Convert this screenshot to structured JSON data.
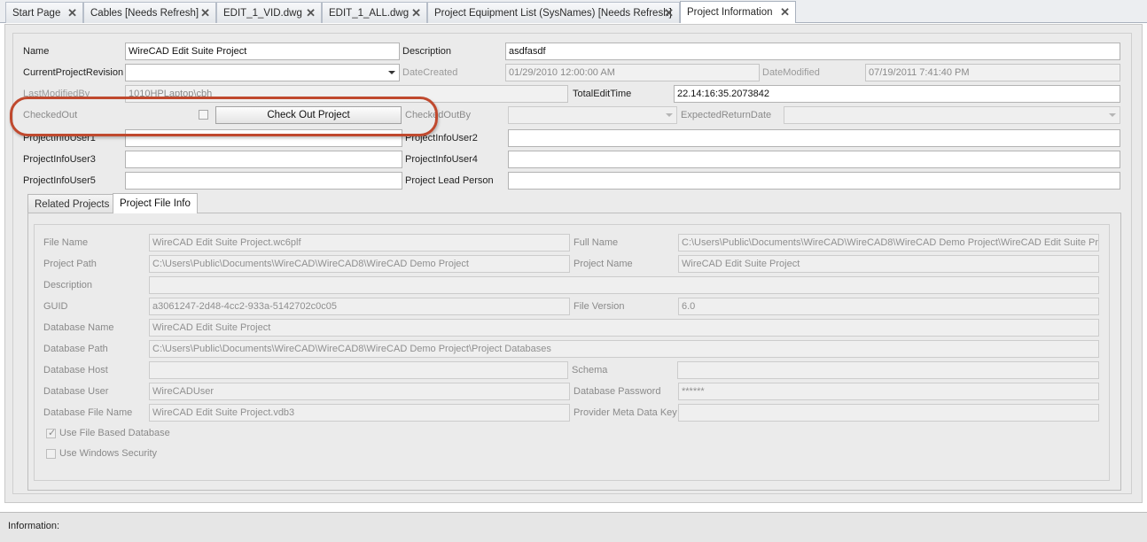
{
  "tabs": [
    {
      "label": "Start Page"
    },
    {
      "label": "Cables [Needs Refresh]"
    },
    {
      "label": "EDIT_1_VID.dwg"
    },
    {
      "label": "EDIT_1_ALL.dwg"
    },
    {
      "label": "Project Equipment List (SysNames) [Needs Refresh]"
    },
    {
      "label": "Project Information"
    }
  ],
  "form": {
    "name_label": "Name",
    "name_value": "WireCAD Edit Suite Project",
    "description_label": "Description",
    "description_value": "asdfasdf",
    "revision_label": "CurrentProjectRevision",
    "revision_value": "",
    "date_created_label": "DateCreated",
    "date_created_value": "01/29/2010 12:00:00 AM",
    "date_modified_label": "DateModified",
    "date_modified_value": "07/19/2011 7:41:40 PM",
    "last_modified_by_label": "LastModifiedBy",
    "last_modified_by_value": "1010HPLaptop\\cbh",
    "total_edit_time_label": "TotalEditTime",
    "total_edit_time_value": "22.14:16:35.2073842",
    "checked_out_label": "CheckedOut",
    "check_out_button": "Check Out Project",
    "checked_out_by_label": "CheckedOutBy",
    "expected_return_label": "ExpectedReturnDate",
    "user1_label": "ProjectInfoUser1",
    "user2_label": "ProjectInfoUser2",
    "user3_label": "ProjectInfoUser3",
    "user4_label": "ProjectInfoUser4",
    "user5_label": "ProjectInfoUser5",
    "lead_label": "Project Lead Person"
  },
  "inner_tabs": [
    {
      "label": "Related Projects"
    },
    {
      "label": "Project File Info"
    }
  ],
  "file_info": {
    "file_name_label": "File Name",
    "file_name_value": "WireCAD Edit Suite Project.wc6plf",
    "full_name_label": "Full Name",
    "full_name_value": "C:\\Users\\Public\\Documents\\WireCAD\\WireCAD8\\WireCAD Demo Project\\WireCAD Edit Suite Pr...",
    "project_path_label": "Project Path",
    "project_path_value": "C:\\Users\\Public\\Documents\\WireCAD\\WireCAD8\\WireCAD Demo Project",
    "project_name_label": "Project Name",
    "project_name_value": "WireCAD Edit Suite Project",
    "description_label": "Description",
    "description_value": "",
    "guid_label": "GUID",
    "guid_value": "a3061247-2d48-4cc2-933a-5142702c0c05",
    "file_version_label": "File Version",
    "file_version_value": "6.0",
    "db_name_label": "Database Name",
    "db_name_value": "WireCAD Edit Suite Project",
    "db_path_label": "Database Path",
    "db_path_value": "C:\\Users\\Public\\Documents\\WireCAD\\WireCAD8\\WireCAD Demo Project\\Project Databases",
    "db_host_label": "Database Host",
    "db_host_value": "",
    "schema_label": "Schema",
    "schema_value": "",
    "db_user_label": "Database User",
    "db_user_value": "WireCADUser",
    "db_password_label": "Database Password",
    "db_password_value": "******",
    "db_file_label": "Database File Name",
    "db_file_value": "WireCAD Edit Suite Project.vdb3",
    "provider_label": "Provider Meta Data Key",
    "provider_value": "",
    "use_file_db_label": "Use File Based Database",
    "use_file_db_checked": true,
    "use_windows_security_label": "Use Windows Security",
    "use_windows_security_checked": false
  },
  "status": {
    "label": "Information:"
  },
  "colors": {
    "highlight": "#c0492e",
    "panel": "#ebebeb"
  }
}
